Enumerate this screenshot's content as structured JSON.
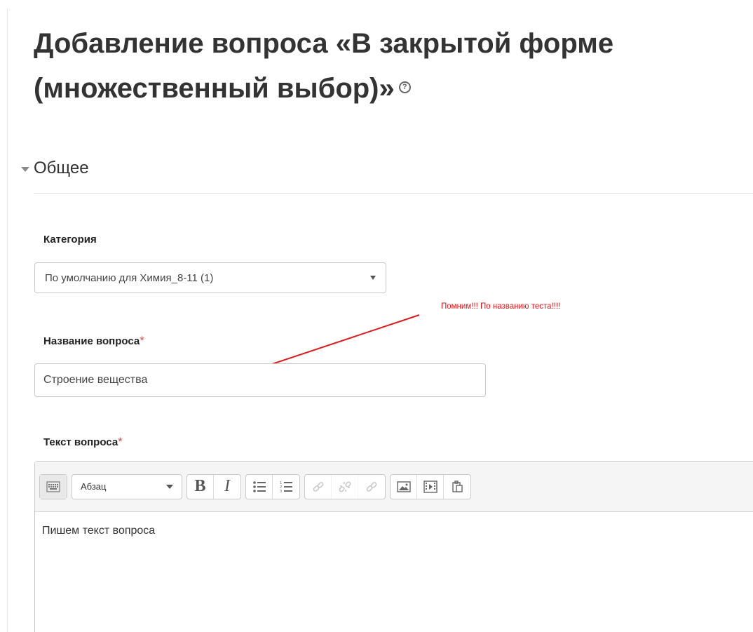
{
  "page": {
    "title": "Добавление вопроса «В закрытой форме (множественный выбор)»",
    "help_icon": "question-circle-icon"
  },
  "section": {
    "label": "Общее",
    "collapse_icon": "triangle-down-icon"
  },
  "fields": {
    "category": {
      "label": "Категория",
      "value": "По умолчанию для Химия_8-11 (1)"
    },
    "question_name": {
      "label": "Название вопроса",
      "required_mark": "*",
      "value": "Строение вещества"
    },
    "question_text": {
      "label": "Текст вопроса",
      "required_mark": "*",
      "content": "Пишем текст вопроса"
    }
  },
  "annotation": {
    "note": "Помним!!! По названию теста!!!!",
    "color": "#e01a1a"
  },
  "toolbar": {
    "paragraph_label": "Абзац",
    "buttons": [
      "toolbar-toggle-icon",
      "bold-icon",
      "italic-icon",
      "bullet-list-icon",
      "numbered-list-icon",
      "link-icon",
      "unlink-icon",
      "anchor-icon",
      "image-icon",
      "media-icon",
      "paste-icon"
    ]
  },
  "colors": {
    "required": "#d9534f",
    "border": "#c9c9c9",
    "toolbar_bg": "#f5f5f5"
  }
}
